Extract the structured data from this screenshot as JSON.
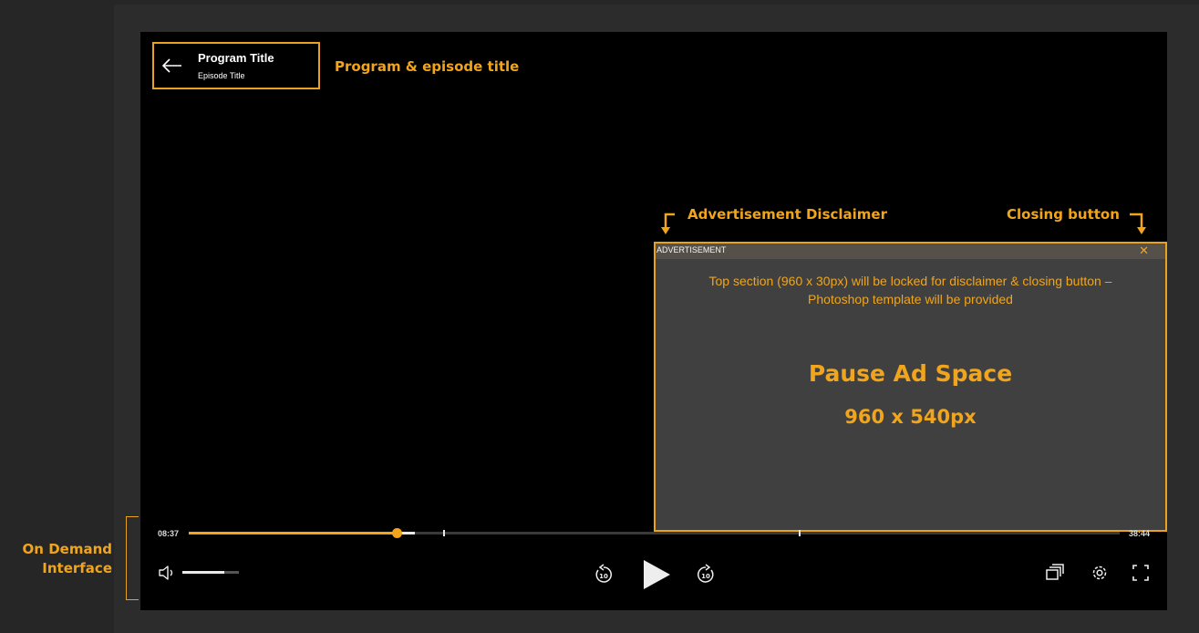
{
  "header": {
    "program_title": "Program Title",
    "episode_title": "Episode Title"
  },
  "annotations": {
    "title_note": "Program & episode title",
    "disclaimer_note": "Advertisement  Disclaimer",
    "closing_note": "Closing button",
    "interface_note": "On Demand Interface"
  },
  "ad": {
    "disclaimer": "ADVERTISEMENT",
    "close_glyph": "✕",
    "template_note": "Top section (960 x 30px) will be locked for disclaimer & closing button – Photoshop template will be provided",
    "space_title": "Pause Ad Space",
    "space_size": "960 x 540px"
  },
  "player": {
    "current_time": "08:37",
    "duration": "38:44",
    "progress": 0.223,
    "buffered": 0.243,
    "volume": 0.74
  },
  "icons": {
    "back": "back-arrow-icon",
    "volume": "volume-icon",
    "rewind": "rewind-10-icon",
    "play": "play-icon",
    "forward": "forward-10-icon",
    "episodes": "episodes-icon",
    "settings": "settings-gear-icon",
    "fullscreen": "fullscreen-icon"
  },
  "colors": {
    "accent": "#f0a51c",
    "player_bg": "#000000",
    "ad_bg": "#404040"
  }
}
